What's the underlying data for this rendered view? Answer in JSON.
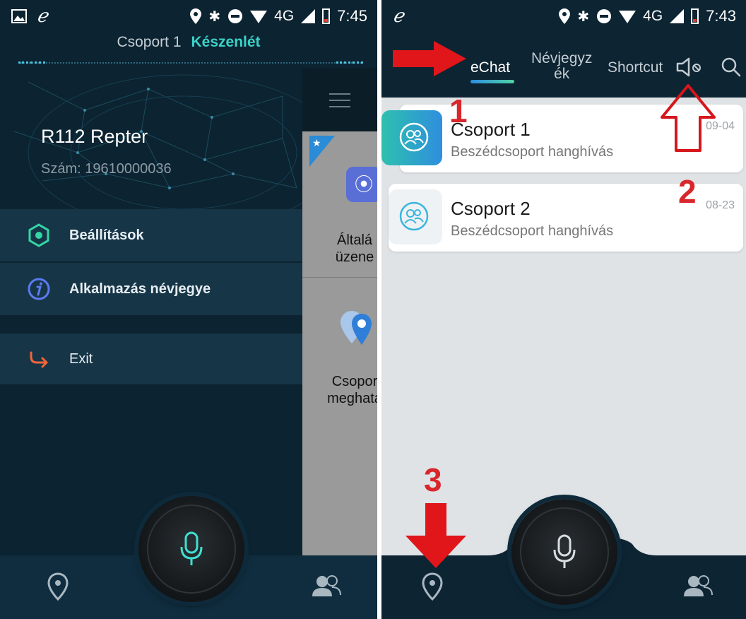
{
  "left_screen": {
    "status": {
      "time": "7:45",
      "network": "4G"
    },
    "header": {
      "group": "Csoport 1",
      "state": "Készenlét"
    },
    "profile": {
      "name": "R112  Repter",
      "number": "Szám: 19610000036"
    },
    "menu": [
      {
        "label": "Beállítások",
        "icon": "settings-hexagon-icon"
      },
      {
        "label": "Alkalmazás névjegye",
        "icon": "info-icon"
      },
      {
        "label": "Exit",
        "icon": "exit-arrow-icon"
      }
    ],
    "peek": {
      "text1_line1": "Általá",
      "text1_line2": "üzene",
      "text2_line1": "Csopor",
      "text2_line2": "meghatá"
    }
  },
  "right_screen": {
    "status": {
      "time": "7:43",
      "network": "4G"
    },
    "tabs": [
      {
        "label": "eChat",
        "active": true
      },
      {
        "label_line1": "Névjegyz",
        "label_line2": "ék",
        "active": false
      },
      {
        "label": "Shortcut",
        "active": false
      }
    ],
    "chats": [
      {
        "title": "Csoport 1",
        "subtitle": "Beszédcsoport hanghívás",
        "date": "09-04"
      },
      {
        "title": "Csoport 2",
        "subtitle": "Beszédcsoport hanghívás",
        "date": "08-23"
      }
    ],
    "annotations": [
      "1",
      "2",
      "3"
    ]
  },
  "colors": {
    "accent_teal": "#39d3c7",
    "annotation_red": "#e0161b",
    "dark_bg": "#0c2331",
    "menu_bg": "#163547"
  }
}
